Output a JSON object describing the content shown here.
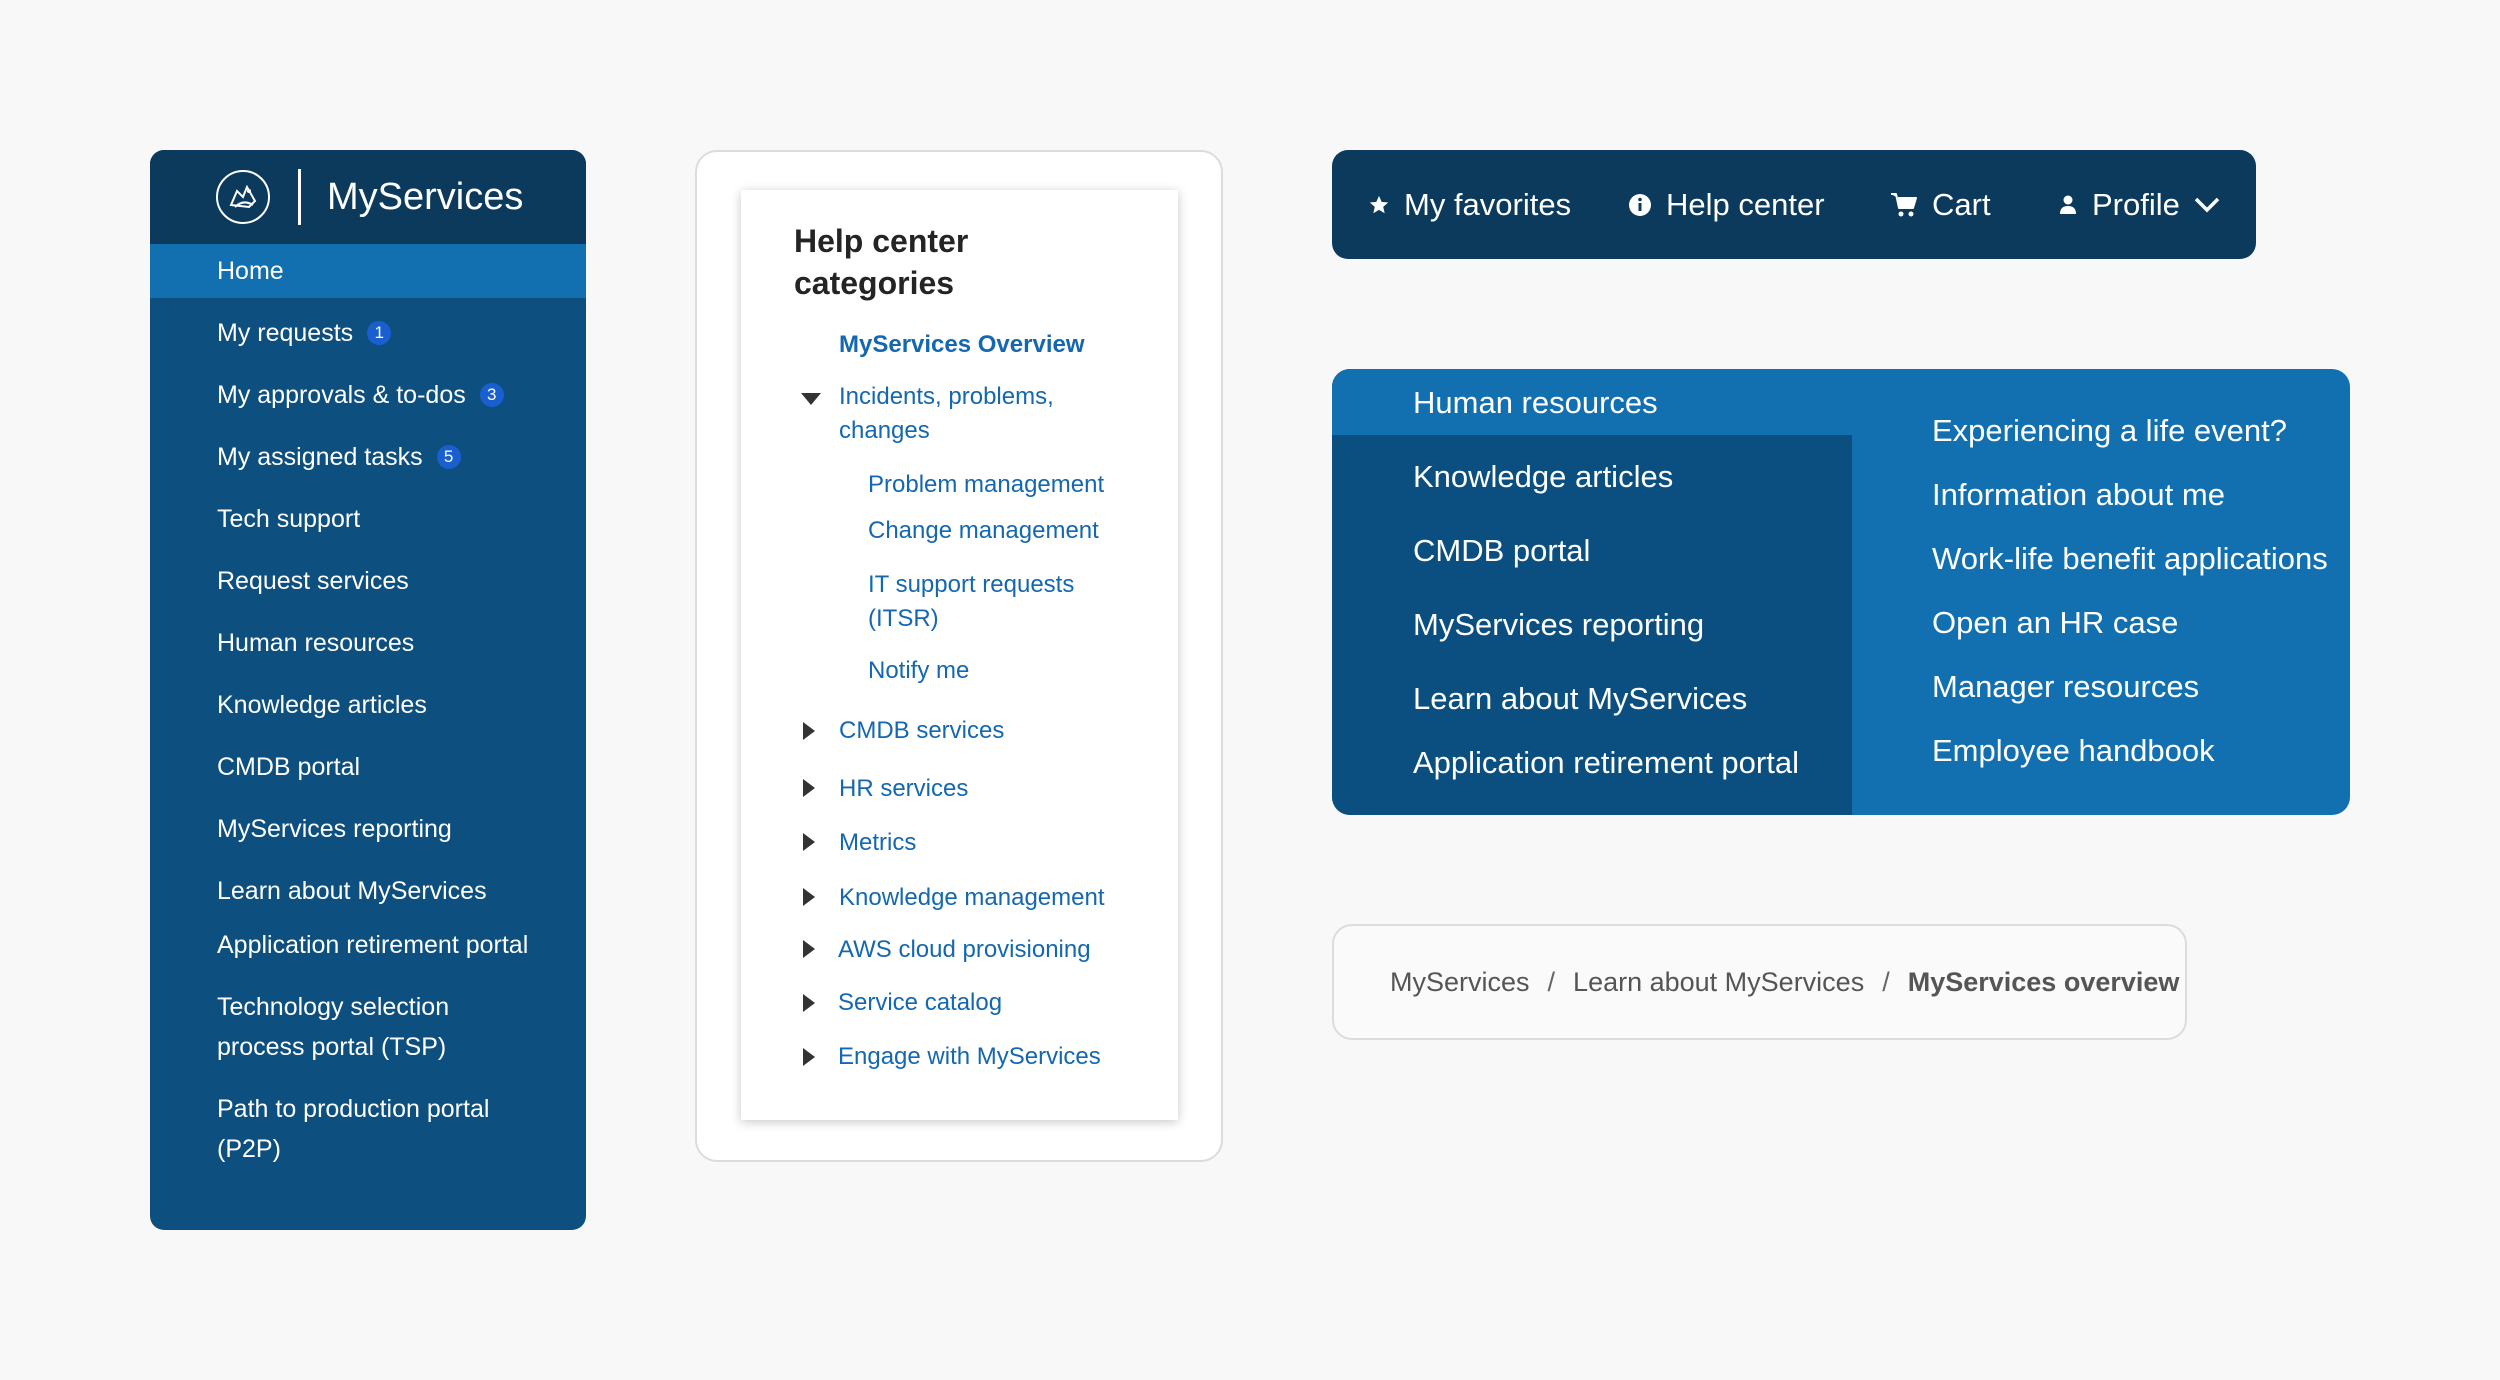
{
  "sidebar": {
    "title": "MyServices",
    "items": [
      {
        "label": "Home"
      },
      {
        "label": "My requests",
        "badge": "1"
      },
      {
        "label": "My approvals & to-dos",
        "badge": "3"
      },
      {
        "label": "My assigned tasks",
        "badge": "5"
      },
      {
        "label": "Tech support"
      },
      {
        "label": "Request services"
      },
      {
        "label": "Human resources"
      },
      {
        "label": "Knowledge articles"
      },
      {
        "label": "CMDB portal"
      },
      {
        "label": "MyServices reporting"
      },
      {
        "label": "Learn about MyServices"
      },
      {
        "label": "Application retirement portal"
      },
      {
        "label": "Technology selection process portal (TSP)"
      },
      {
        "label": "Path to production portal (P2P)"
      }
    ]
  },
  "help_center": {
    "title": "Help center categories",
    "overview": "MyServices Overview",
    "expanded": {
      "label": "Incidents, problems, changes",
      "children": [
        "Problem management",
        "Change management",
        "IT support requests (ITSR)",
        "Notify me"
      ]
    },
    "collapsed": [
      "CMDB services",
      "HR services",
      "Metrics",
      "Knowledge management",
      "AWS cloud provisioning",
      "Service catalog",
      "Engage with MyServices"
    ]
  },
  "topnav": {
    "favorites": "My favorites",
    "help": "Help center",
    "cart": "Cart",
    "profile": "Profile",
    "icons": [
      "star-icon",
      "info-icon",
      "cart-icon",
      "person-icon",
      "chevron-down-icon"
    ]
  },
  "mega_menu": {
    "left": [
      "Human resources",
      "Knowledge articles",
      "CMDB portal",
      "MyServices reporting",
      "Learn about MyServices",
      "Application retirement portal"
    ],
    "right": [
      "Experiencing a life event?",
      "Information about me",
      "Work-life benefit applications",
      "Open an HR case",
      "Manager resources",
      "Employee handbook"
    ]
  },
  "breadcrumb": {
    "items": [
      "MyServices",
      "Learn about MyServices",
      "MyServices overview"
    ],
    "separator": "/"
  },
  "colors": {
    "navy": "#0b3a5d",
    "sidebar_blue": "#0d4f7f",
    "active_blue": "#1270b0",
    "link_blue": "#1467b0",
    "badge_blue": "#1a5fd0"
  }
}
